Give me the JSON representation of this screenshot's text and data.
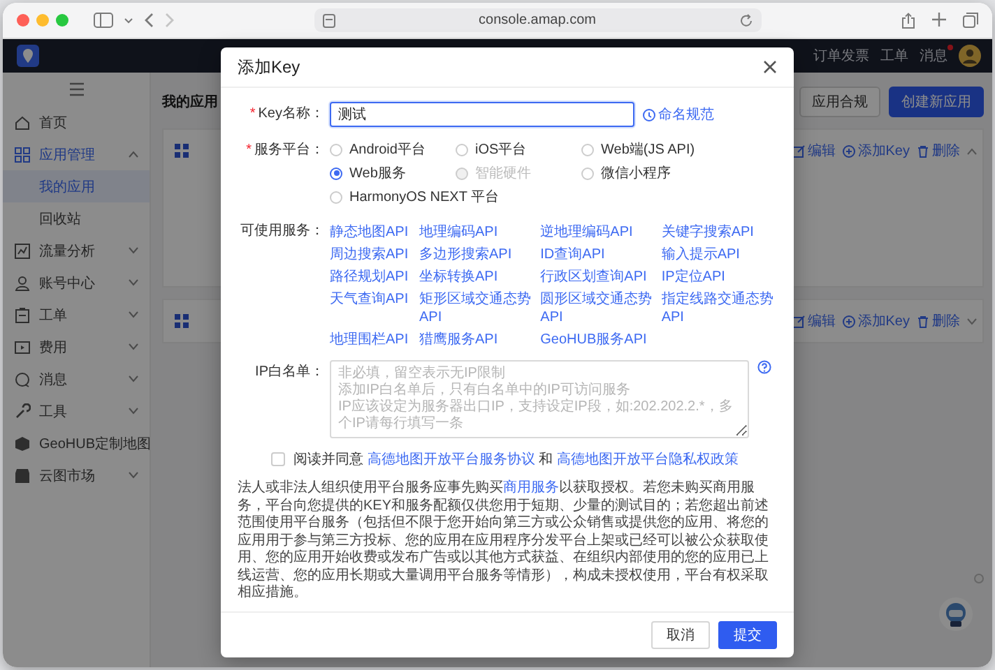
{
  "browser": {
    "url": "console.amap.com"
  },
  "top_nav": {
    "items": [
      {
        "label": "订单发票",
        "dot": false
      },
      {
        "label": "工单",
        "dot": false
      },
      {
        "label": "消息",
        "dot": true
      }
    ]
  },
  "sidebar": {
    "items": [
      {
        "label": "首页",
        "kind": "link",
        "selected": false
      },
      {
        "label": "应用管理",
        "kind": "group",
        "expanded": true,
        "children": [
          {
            "label": "我的应用",
            "selected": true
          },
          {
            "label": "回收站",
            "selected": false
          }
        ]
      },
      {
        "label": "流量分析",
        "kind": "group",
        "expanded": false
      },
      {
        "label": "账号中心",
        "kind": "group",
        "expanded": false
      },
      {
        "label": "工单",
        "kind": "group",
        "expanded": false
      },
      {
        "label": "费用",
        "kind": "group",
        "expanded": false
      },
      {
        "label": "消息",
        "kind": "group",
        "expanded": false
      },
      {
        "label": "工具",
        "kind": "group",
        "expanded": false
      },
      {
        "label": "GeoHUB定制地图",
        "kind": "link",
        "selected": false
      },
      {
        "label": "云图市场",
        "kind": "group",
        "expanded": false
      }
    ]
  },
  "page": {
    "title": "我的应用",
    "buttons": [
      {
        "label": "应用合规",
        "kind": "default"
      },
      {
        "label": "创建新应用",
        "kind": "primary"
      }
    ]
  },
  "apps": [
    {
      "expanded": true,
      "actions": [
        {
          "kind": "edit",
          "label": "编辑"
        },
        {
          "kind": "add",
          "label": "添加Key"
        },
        {
          "kind": "delete",
          "label": "删除"
        }
      ]
    },
    {
      "expanded": false,
      "actions": [
        {
          "kind": "edit",
          "label": "编辑"
        },
        {
          "kind": "add",
          "label": "添加Key"
        },
        {
          "kind": "delete",
          "label": "删除"
        }
      ]
    }
  ],
  "dialog": {
    "title": "添加Key",
    "key_name": {
      "required_mark": "*",
      "label": "Key名称：",
      "value": "测试",
      "focused": true,
      "help_link": "命名规范"
    },
    "platform": {
      "required_mark": "*",
      "label": "服务平台：",
      "options": [
        {
          "label": "Android平台",
          "selected": false,
          "disabled": false
        },
        {
          "label": "iOS平台",
          "selected": false,
          "disabled": false
        },
        {
          "label": "Web端(JS API)",
          "selected": false,
          "disabled": false
        },
        {
          "label": "Web服务",
          "selected": true,
          "disabled": false
        },
        {
          "label": "智能硬件",
          "selected": false,
          "disabled": true
        },
        {
          "label": "微信小程序",
          "selected": false,
          "disabled": false
        },
        {
          "label": "HarmonyOS NEXT 平台",
          "selected": false,
          "disabled": false
        }
      ]
    },
    "services": {
      "label": "可使用服务：",
      "items": [
        "静态地图API",
        "地理编码API",
        "逆地理编码API",
        "关键字搜索API",
        "周边搜索API",
        "多边形搜索API",
        "ID查询API",
        "输入提示API",
        "路径规划API",
        "坐标转换API",
        "行政区划查询API",
        "IP定位API",
        "天气查询API",
        "矩形区域交通态势API",
        "圆形区域交通态势API",
        "指定线路交通态势API",
        "地理围栏API",
        "猎鹰服务API",
        "GeoHUB服务API"
      ]
    },
    "ip_whitelist": {
      "label": "IP白名单：",
      "placeholder": [
        "非必填，留空表示无IP限制",
        "添加IP白名单后，只有白名单中的IP可访问服务",
        "IP应该设定为服务器出口IP，支持设定IP段，如:202.202.2.*，多个IP请每行填写一条"
      ]
    },
    "agreement": {
      "checked": false,
      "parts": [
        {
          "kind": "text",
          "text": "阅读并同意 "
        },
        {
          "kind": "link",
          "text": "高德地图开放平台服务协议"
        },
        {
          "kind": "text",
          "text": " 和 "
        },
        {
          "kind": "link",
          "text": "高德地图开放平台隐私权政策"
        }
      ]
    },
    "notice": {
      "parts": [
        {
          "kind": "text",
          "text": "法人或非法人组织使用平台服务应事先购买"
        },
        {
          "kind": "link",
          "text": "商用服务"
        },
        {
          "kind": "text",
          "text": "以获取授权。若您未购买商用服务，平台向您提供的KEY和服务配额仅供您用于短期、少量的测试目的；若您超出前述范围使用平台服务（包括但不限于您开始向第三方或公众销售或提供您的应用、将您的应用用于参与第三方投标、您的应用在应用程序分发平台上架或已经可以被公众获取使用、您的应用开始收费或发布广告或以其他方式获益、在组织内部使用的您的应用已上线运营、您的应用长期或大量调用平台服务等情形），构成未授权使用，平台有权采取相应措施。"
        }
      ]
    },
    "buttons": [
      {
        "label": "取消",
        "kind": "default"
      },
      {
        "label": "提交",
        "kind": "primary"
      }
    ]
  }
}
